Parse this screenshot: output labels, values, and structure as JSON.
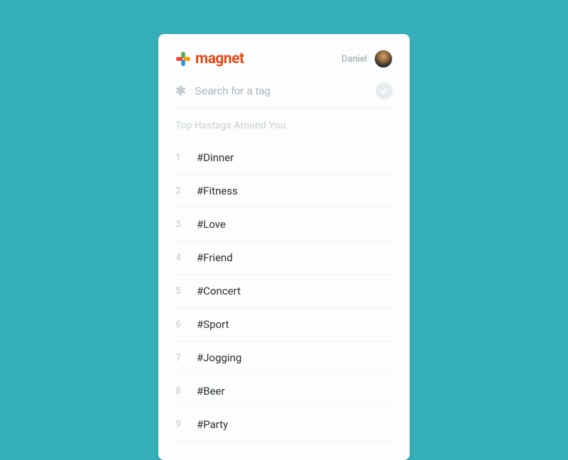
{
  "header": {
    "logo_text": "magnet",
    "user_name": "Daniel"
  },
  "search": {
    "placeholder": "Search for a tag"
  },
  "section": {
    "title": "Top Hastags Around You"
  },
  "hashtags": [
    {
      "rank": "1",
      "tag": "#Dinner"
    },
    {
      "rank": "2",
      "tag": "#Fitness"
    },
    {
      "rank": "3",
      "tag": "#Love"
    },
    {
      "rank": "4",
      "tag": "#Friend"
    },
    {
      "rank": "5",
      "tag": "#Concert"
    },
    {
      "rank": "6",
      "tag": "#Sport"
    },
    {
      "rank": "7",
      "tag": "#Jogging"
    },
    {
      "rank": "8",
      "tag": "#Beer"
    },
    {
      "rank": "9",
      "tag": "#Party"
    }
  ]
}
